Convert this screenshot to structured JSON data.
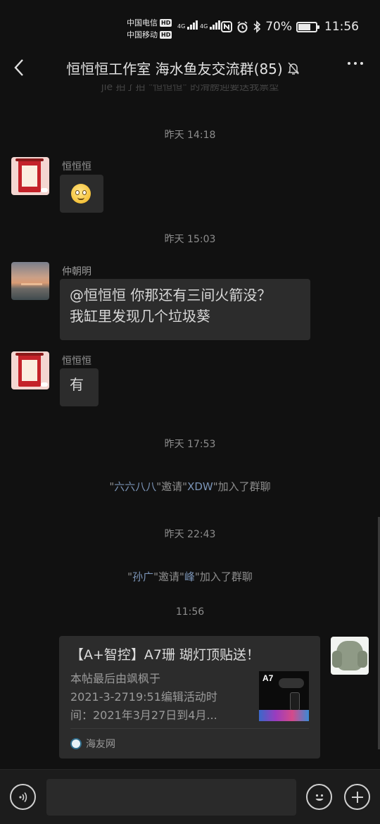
{
  "status_bar": {
    "carrier1": "中国电信",
    "carrier2": "中国移动",
    "hd_badge": "HD",
    "network1": "4G",
    "network2": "4G",
    "battery_level": "70%",
    "battery_fraction": 0.7,
    "time": "11:56"
  },
  "header": {
    "title": "恒恒恒工作室 海水鱼友交流群(85)",
    "mute_icon": "bell-off-icon",
    "back_icon": "chevron-left-icon",
    "more_icon": "more-dots-icon"
  },
  "chat": {
    "partial_top_text": "jie  拍了拍 \"恒恒恒\" 的滑膀迎要送我票型",
    "timestamps": [
      "昨天 14:18",
      "昨天 15:03",
      "昨天 17:53",
      "昨天 22:43",
      "11:56"
    ],
    "messages": [
      {
        "sender": "恒恒恒",
        "emoji": "slightly-smiling-emoji"
      },
      {
        "sender": "仲朝明",
        "line1": "@恒恒恒  你那还有三间火箭没？",
        "line2": "我缸里发现几个垃圾葵"
      },
      {
        "sender": "恒恒恒",
        "text": "有"
      }
    ],
    "system_messages": [
      {
        "q1": "\"",
        "actor": "六六八八",
        "mid": "\"邀请\"",
        "target": "XDW",
        "end": "\"加入了群聊"
      },
      {
        "q1": "\"",
        "actor": "孙广",
        "mid": "\"邀请\"",
        "target": "峰",
        "end": "\"加入了群聊"
      }
    ],
    "link_card": {
      "title": "【A+智控】A7珊 瑚灯顶贴送！",
      "desc_line1": "本帖最后由飒枫于",
      "desc_line2": "2021-3-2719:51编辑活动时",
      "desc_line3": "间：2021年3月27日到4月...",
      "thumb_text": "A7",
      "source": "海友网"
    }
  },
  "input_bar": {
    "placeholder": "",
    "voice_icon": "voice-icon",
    "emoji_icon": "emoji-icon",
    "plus_icon": "plus-icon"
  },
  "colors": {
    "background": "#111111",
    "bubble": "#2c2c2c",
    "system_highlight": "#7b94b7"
  }
}
